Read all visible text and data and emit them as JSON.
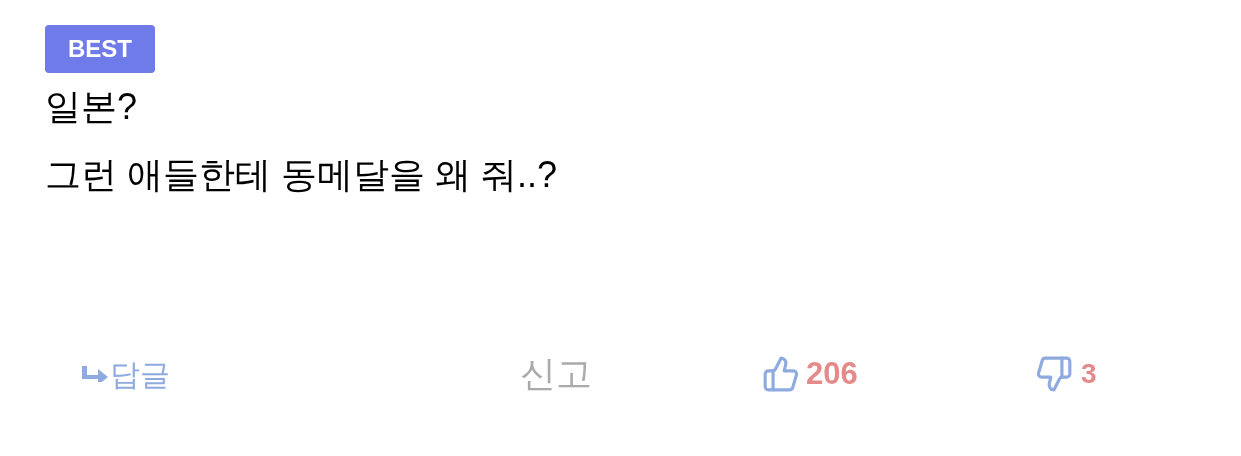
{
  "badge": "BEST",
  "comment_lines": [
    "일본?",
    "그런 애들한테 동메달을 왜 줘..?"
  ],
  "actions": {
    "reply": "답글",
    "report": "신고",
    "likes": "206",
    "dislikes": "3"
  }
}
